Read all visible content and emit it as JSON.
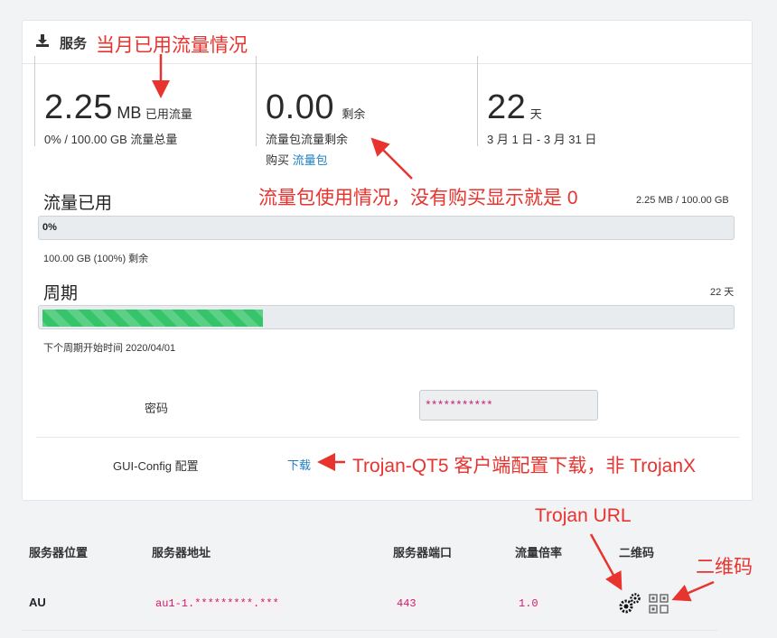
{
  "header": {
    "title": "服务"
  },
  "stats": {
    "used": {
      "value": "2.25",
      "unit": "MB",
      "label": "已用流量",
      "sub": "0% / 100.00 GB 流量总量"
    },
    "remaining": {
      "value": "0.00",
      "label": "剩余",
      "sub": "流量包流量剩余",
      "buy_prefix": "购买",
      "buy_link": "流量包"
    },
    "days": {
      "value": "22",
      "unit": "天",
      "sub": "3 月 1 日 - 3 月 31 日"
    }
  },
  "traffic": {
    "title": "流量已用",
    "right": "2.25 MB / 100.00 GB",
    "bar_label": "0%",
    "progress": 0,
    "note": "100.00 GB (100%) 剩余"
  },
  "cycle": {
    "title": "周期",
    "right": "22 天",
    "progress": 0.32,
    "note": "下个周期开始时间 2020/04/01"
  },
  "password": {
    "label": "密码",
    "value": "***********"
  },
  "gui_config": {
    "label": "GUI-Config 配置",
    "link": "下载"
  },
  "table": {
    "headers": [
      "服务器位置",
      "服务器地址",
      "服务器端口",
      "流量倍率",
      "二维码"
    ],
    "row": {
      "location": "AU",
      "address": "au1-1.*********.***",
      "port": "443",
      "rate": "1.0"
    }
  },
  "annotations": {
    "month_usage": "当月已用流量情况",
    "package_usage": "流量包使用情况，没有购买显示就是 0",
    "qt5_download": "Trojan-QT5 客户端配置下载，非 TrojanX",
    "trojan_url": "Trojan URL",
    "qrcode": "二维码"
  },
  "colors": {
    "annotation": "#e8332e",
    "link": "#1e7fc0",
    "progress": "#35c46a",
    "code": "#c81e6e"
  },
  "icons": {
    "header": "download-icon",
    "settings": "gears-icon",
    "qr": "qrcode-icon"
  }
}
